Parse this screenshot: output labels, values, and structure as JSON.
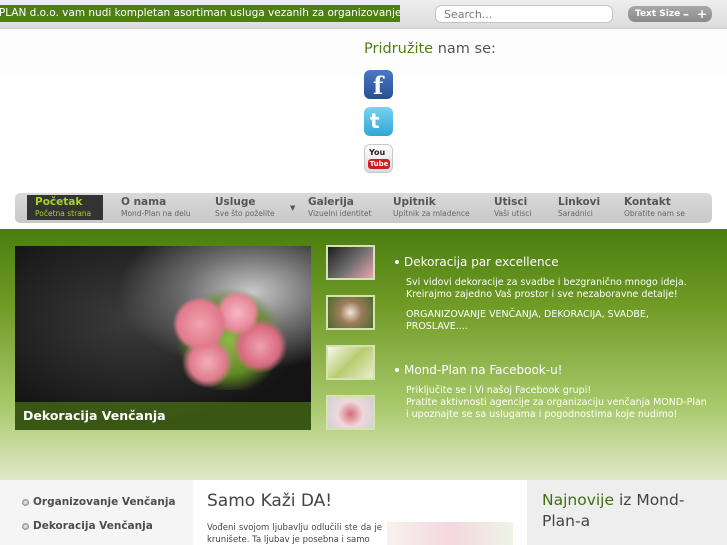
{
  "topbar": {
    "ticker": "D-PLAN d.o.o. vam nudi kompletan asortiman usluga vezanih za organizovanje venčanja. Celok",
    "search_placeholder": "Search...",
    "text_size_label": "Text Size",
    "minus": "–",
    "plus": "+"
  },
  "social": {
    "heading_highlight": "Pridružite",
    "heading_rest": " nam se:",
    "icons": [
      "facebook-icon",
      "twitter-icon",
      "youtube-icon"
    ],
    "facebook_glyph": "f",
    "twitter_glyph": "t",
    "youtube_top": "You",
    "youtube_bottom": "Tube"
  },
  "nav": {
    "items": [
      {
        "title": "Početak",
        "sub": "Početna strana"
      },
      {
        "title": "O nama",
        "sub": "Mond-Plan na delu"
      },
      {
        "title": "Usluge",
        "sub": "Sve što poželite"
      },
      {
        "title": "Galerija",
        "sub": "Vizuelni identitet"
      },
      {
        "title": "Upitnik",
        "sub": "Upitnik za mladence"
      },
      {
        "title": "Utisci",
        "sub": "Vaši utisci"
      },
      {
        "title": "Linkovi",
        "sub": "Saradnici"
      },
      {
        "title": "Kontakt",
        "sub": "Obratite nam se"
      }
    ],
    "dropdown_arrow": "▼"
  },
  "slider": {
    "caption": "Dekoracija Venčanja"
  },
  "news": [
    {
      "title": "Dekoracija par excellence",
      "body1": "Svi vidovi dekoracije za svadbe i bezgranično mnogo ideja. Kreirajmo zajedno Vaš prostor i sve nezaboravne detalje!",
      "body2": "ORGANIZOVANJE VENČANJA, DEKORACIJA, SVADBE, PROSLAVE...."
    },
    {
      "title": "Mond-Plan na Facebook-u!",
      "body1": "Priključite se i Vi našoj Facebook grupi!",
      "body2": "Pratite aktivnosti agencije za organizaciju venčanja MOND-Plan i upoznajte se sa uslugama i pogodnostima koje nudimo!"
    }
  ],
  "left_menu": [
    "Organizovanje Venčanja",
    "Dekoracija Venčanja"
  ],
  "main": {
    "title": "Samo Kaži DA!",
    "text": "Vođeni svojom ljubavlju odlučili ste da je krunišete. Ta ljubav je posebna i samo"
  },
  "latest": {
    "heading_highlight": "Najnovije",
    "heading_rest": " iz Mond-Plan-a"
  }
}
